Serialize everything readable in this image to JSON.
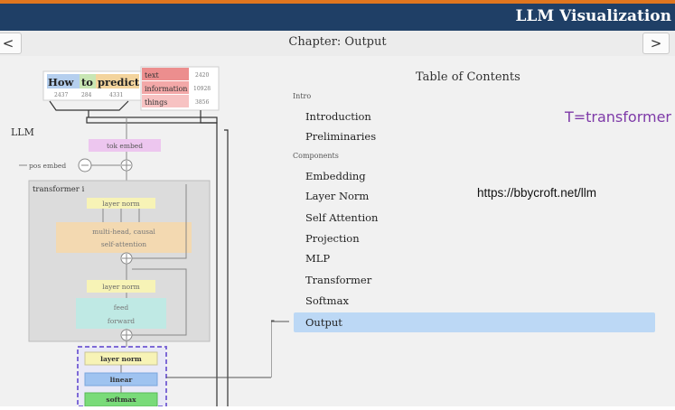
{
  "header": {
    "app_title": "LLM Visualization"
  },
  "nav": {
    "prev_label": "<",
    "next_label": ">",
    "chapter": "Chapter: Output"
  },
  "diagram": {
    "tokens": [
      {
        "word": "How",
        "id": "2437",
        "color": "#b5cfee"
      },
      {
        "word": "to",
        "id": "284",
        "color": "#c8e6b4"
      },
      {
        "word": "predict",
        "id": "4331",
        "color": "#f3d49d"
      }
    ],
    "predictions": [
      {
        "word": "text",
        "id": "2420"
      },
      {
        "word": "information",
        "id": "10928"
      },
      {
        "word": "things",
        "id": "3856"
      }
    ],
    "llm_label": "LLM",
    "tok_embed": "tok embed",
    "pos_embed": "pos embed",
    "transformer_label": "transformer i",
    "layer_norm_1": "layer norm",
    "attention_line1": "multi-head, causal",
    "attention_line2": "self-attention",
    "layer_norm_2": "layer norm",
    "ffn_line1": "feed",
    "ffn_line2": "forward",
    "out_layer_norm": "layer norm",
    "out_linear": "linear",
    "out_softmax": "softmax"
  },
  "toc": {
    "title": "Table of Contents",
    "section_intro": "Intro",
    "section_components": "Components",
    "items": [
      {
        "label": "Introduction"
      },
      {
        "label": "Preliminaries"
      },
      {
        "label": "Embedding"
      },
      {
        "label": "Layer Norm"
      },
      {
        "label": "Self Attention"
      },
      {
        "label": "Projection"
      },
      {
        "label": "MLP"
      },
      {
        "label": "Transformer"
      },
      {
        "label": "Softmax"
      },
      {
        "label": "Output"
      }
    ],
    "active_index": 9
  },
  "annotations": {
    "t_note": "T=transformer",
    "url": "https://bbycroft.net/llm"
  },
  "colors": {
    "header_bg": "#1f3f66",
    "accent_orange": "#e0761f",
    "active_item": "#bcd8f5",
    "annotation_purple": "#7e3aa8"
  }
}
